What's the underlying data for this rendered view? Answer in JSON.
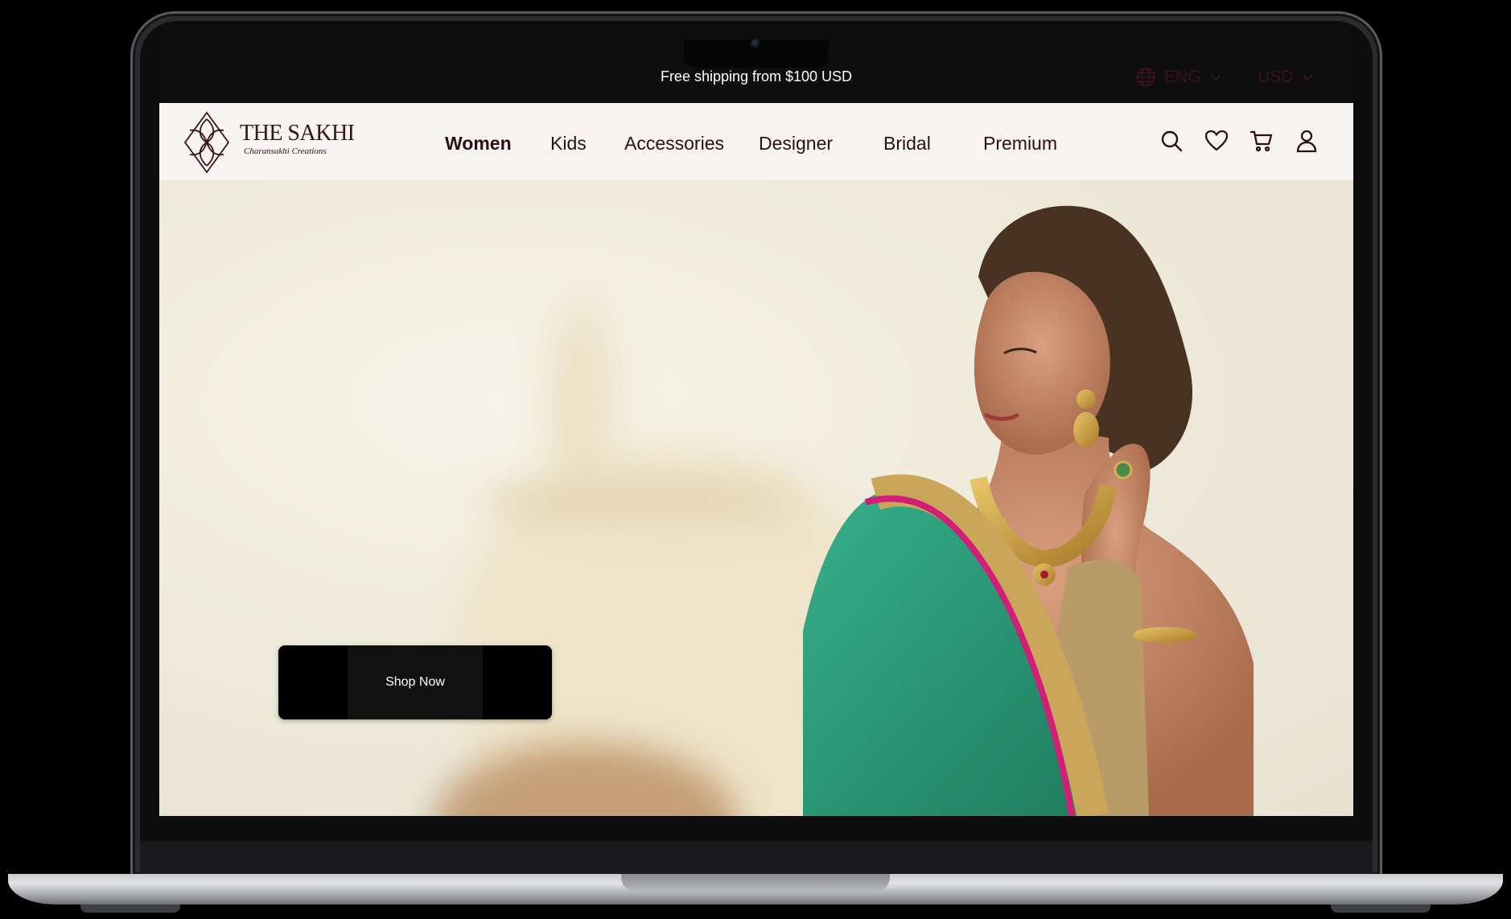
{
  "announcement": {
    "text": "Free shipping from $100 USD"
  },
  "locale": {
    "language": "ENG",
    "currency": "USD",
    "globe_icon": "globe-icon",
    "chevron_icon": "chevron-down-icon"
  },
  "brand": {
    "name": "THE SAKHI",
    "tagline": "Charansakhi Creations",
    "logo_icon": "lotus-logo-icon"
  },
  "nav": {
    "items": [
      {
        "label": "Women",
        "active": true
      },
      {
        "label": "Kids",
        "active": false
      },
      {
        "label": "Accessories",
        "active": false
      },
      {
        "label": "Designer",
        "active": false
      },
      {
        "label": "Bridal",
        "active": false
      },
      {
        "label": "Premium",
        "active": false
      }
    ],
    "icons": [
      "search-icon",
      "heart-icon",
      "cart-icon",
      "user-icon"
    ]
  },
  "hero": {
    "cta_label": "Shop Now",
    "image": "model-in-green-saree-with-gold-jewellery"
  },
  "colors": {
    "topbar_bg": "#0e0e0e",
    "navbar_bg": "#f7f4f1",
    "brand_maroon": "#3a1120",
    "nav_text": "#2c0d1a",
    "hero_bg": "#eeebdc",
    "saree_green": "#2e9e78",
    "cta_bg": "#000000"
  }
}
